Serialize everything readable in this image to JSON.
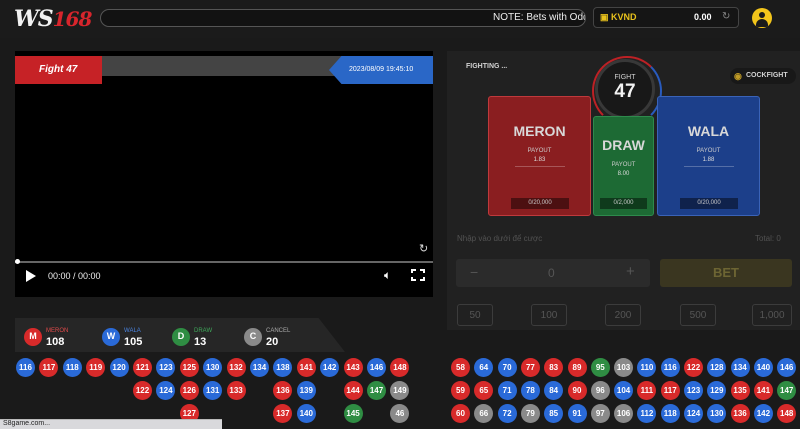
{
  "header": {
    "logo_main": "WS",
    "logo_num": "168",
    "notice": "NOTE: Bets with Odd",
    "wallet_currency": "KVND",
    "wallet_balance": "0.00",
    "wallet_refresh_icon": "refresh-icon"
  },
  "video": {
    "fight_label": "Fight 47",
    "datetime": "2023/08/09 19:45:10",
    "time": "00:00 / 00:00",
    "progress": 0
  },
  "betting": {
    "status": "FIGHTING ...",
    "cockfight_label": "COCKFIGHT",
    "fight_label": "FIGHT",
    "fight_number": "47",
    "options": {
      "meron": {
        "name": "MERON",
        "payout_label": "PAYOUT",
        "payout": "1.83",
        "limit": "0/20,000"
      },
      "draw": {
        "name": "DRAW",
        "payout_label": "PAYOUT",
        "payout": "8.00",
        "limit": "0/2,000"
      },
      "wala": {
        "name": "WALA",
        "payout_label": "PAYOUT",
        "payout": "1.88",
        "limit": "0/20,000"
      }
    },
    "input_hint": "Nhập vào dưới để cược",
    "total_label": "Total: 0",
    "stake_value": "0",
    "minus": "−",
    "plus": "+",
    "bet_button": "BET",
    "chips": [
      "50",
      "100",
      "200",
      "500",
      "1,000"
    ]
  },
  "stats": {
    "meron": {
      "badge": "M",
      "label": "MERON",
      "count": "108",
      "color": "#d82a2a"
    },
    "wala": {
      "badge": "W",
      "label": "WALA",
      "count": "105",
      "color": "#2a6ad8"
    },
    "draw": {
      "badge": "D",
      "label": "DRAW",
      "count": "13",
      "color": "#2f8d43"
    },
    "cancel": {
      "badge": "C",
      "label": "CANCEL",
      "count": "20",
      "color": "#8a8a8a"
    }
  },
  "road_left": [
    [
      {
        "n": "116",
        "c": "b"
      },
      {
        "n": "117",
        "c": "r"
      },
      {
        "n": "118",
        "c": "b"
      },
      {
        "n": "119",
        "c": "r"
      },
      {
        "n": "120",
        "c": "b"
      },
      {
        "n": "121",
        "c": "r"
      },
      {
        "n": "123",
        "c": "b"
      },
      {
        "n": "125",
        "c": "r"
      },
      {
        "n": "130",
        "c": "b"
      },
      {
        "n": "132",
        "c": "r"
      },
      {
        "n": "134",
        "c": "b"
      },
      {
        "n": "138",
        "c": "b"
      },
      {
        "n": "141",
        "c": "r"
      },
      {
        "n": "142",
        "c": "b"
      },
      {
        "n": "143",
        "c": "r"
      },
      {
        "n": "146",
        "c": "b"
      },
      {
        "n": "148",
        "c": "r"
      }
    ],
    [
      null,
      null,
      null,
      null,
      null,
      {
        "n": "122",
        "c": "r"
      },
      {
        "n": "124",
        "c": "b"
      },
      {
        "n": "126",
        "c": "r"
      },
      {
        "n": "131",
        "c": "b"
      },
      {
        "n": "133",
        "c": "r"
      },
      null,
      {
        "n": "136",
        "c": "r"
      },
      {
        "n": "139",
        "c": "b"
      },
      null,
      {
        "n": "144",
        "c": "r"
      },
      {
        "n": "147",
        "c": "g"
      },
      {
        "n": "149",
        "c": "c"
      }
    ],
    [
      null,
      null,
      null,
      null,
      null,
      null,
      null,
      {
        "n": "127",
        "c": "r"
      },
      null,
      null,
      null,
      {
        "n": "137",
        "c": "r"
      },
      {
        "n": "140",
        "c": "b"
      },
      null,
      {
        "n": "145",
        "c": "g"
      },
      null,
      {
        "n": "46",
        "c": "c"
      }
    ]
  ],
  "road_right": [
    [
      {
        "n": "58",
        "c": "r"
      },
      {
        "n": "64",
        "c": "b"
      },
      {
        "n": "70",
        "c": "b"
      },
      {
        "n": "77",
        "c": "r"
      },
      {
        "n": "83",
        "c": "r"
      },
      {
        "n": "89",
        "c": "r"
      },
      {
        "n": "95",
        "c": "g"
      },
      {
        "n": "103",
        "c": "c"
      },
      {
        "n": "110",
        "c": "b"
      },
      {
        "n": "116",
        "c": "b"
      },
      {
        "n": "122",
        "c": "r"
      },
      {
        "n": "128",
        "c": "b"
      },
      {
        "n": "134",
        "c": "b"
      },
      {
        "n": "140",
        "c": "b"
      },
      {
        "n": "146",
        "c": "b"
      }
    ],
    [
      {
        "n": "59",
        "c": "r"
      },
      {
        "n": "65",
        "c": "r"
      },
      {
        "n": "71",
        "c": "b"
      },
      {
        "n": "78",
        "c": "b"
      },
      {
        "n": "84",
        "c": "b"
      },
      {
        "n": "90",
        "c": "r"
      },
      {
        "n": "96",
        "c": "c"
      },
      {
        "n": "104",
        "c": "b"
      },
      {
        "n": "111",
        "c": "r"
      },
      {
        "n": "117",
        "c": "r"
      },
      {
        "n": "123",
        "c": "b"
      },
      {
        "n": "129",
        "c": "b"
      },
      {
        "n": "135",
        "c": "r"
      },
      {
        "n": "141",
        "c": "r"
      },
      {
        "n": "147",
        "c": "g"
      }
    ],
    [
      {
        "n": "60",
        "c": "r"
      },
      {
        "n": "66",
        "c": "c"
      },
      {
        "n": "72",
        "c": "b"
      },
      {
        "n": "79",
        "c": "c"
      },
      {
        "n": "85",
        "c": "b"
      },
      {
        "n": "91",
        "c": "b"
      },
      {
        "n": "97",
        "c": "c"
      },
      {
        "n": "106",
        "c": "c"
      },
      {
        "n": "112",
        "c": "b"
      },
      {
        "n": "118",
        "c": "b"
      },
      {
        "n": "124",
        "c": "b"
      },
      {
        "n": "130",
        "c": "b"
      },
      {
        "n": "136",
        "c": "r"
      },
      {
        "n": "142",
        "c": "b"
      },
      {
        "n": "148",
        "c": "r"
      }
    ]
  ],
  "footer": {
    "url": "S8game.com..."
  }
}
